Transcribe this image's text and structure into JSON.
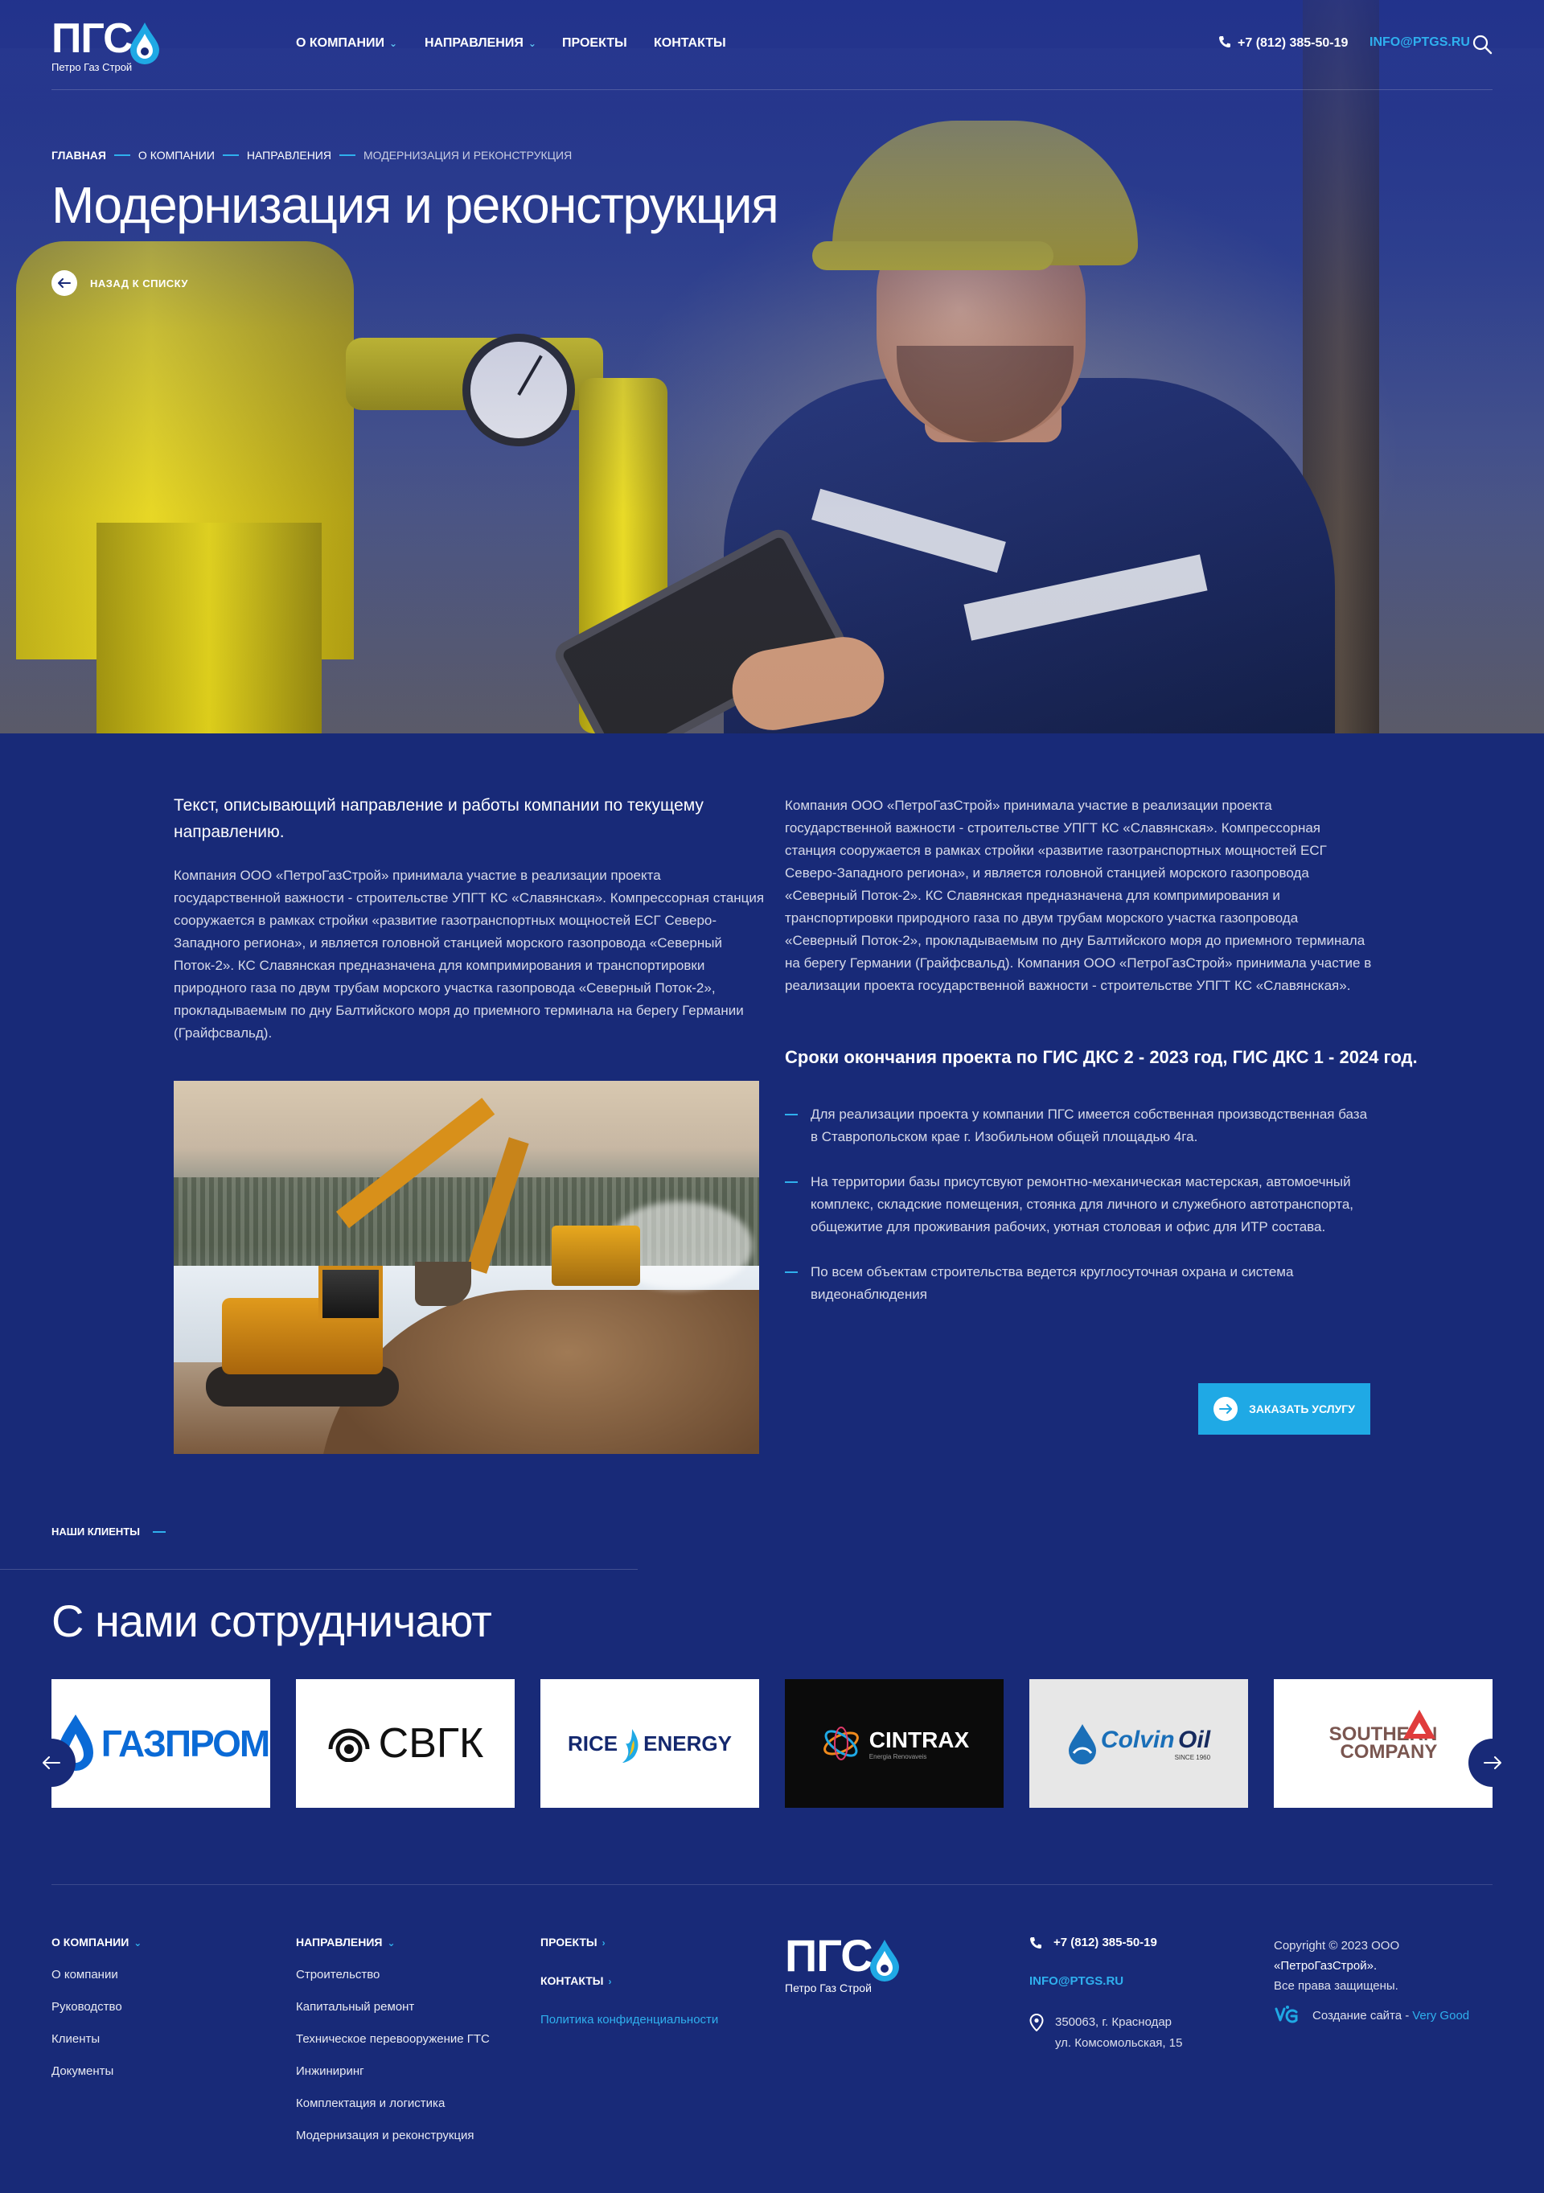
{
  "header": {
    "logo_text": "ПГС",
    "logo_subtitle": "Петро Газ Строй",
    "nav": [
      {
        "label": "О КОМПАНИИ",
        "has_dropdown": true
      },
      {
        "label": "НАПРАВЛЕНИЯ",
        "has_dropdown": true
      },
      {
        "label": "ПРОЕКТЫ",
        "has_dropdown": false
      },
      {
        "label": "КОНТАКТЫ",
        "has_dropdown": false
      }
    ],
    "phone": "+7 (812) 385-50-19",
    "email": "INFO@PTGS.RU",
    "search_icon": "search-icon"
  },
  "hero": {
    "breadcrumb": [
      "ГЛАВНАЯ",
      "О КОМПАНИИ",
      "НАПРАВЛЕНИЯ",
      "МОДЕРНИЗАЦИЯ И РЕКОНСТРУКЦИЯ"
    ],
    "title": "Модернизация и реконструкция",
    "back_label": "НАЗАД К СПИСКУ"
  },
  "content": {
    "lead": "Текст, описывающий направление и работы компании по текущему направлению.",
    "left_paragraph": "Компания ООО «ПетроГазСтрой» принимала участие в реализации проекта государственной важности -  строительстве УПГТ КС «Славянская». Компрессорная станция сооружается в рамках стройки «развитие газотранспортных мощностей ЕСГ Северо-Западного региона», и является головной станцией морского газопровода «Северный Поток-2». КС Славянская предназначена для компримирования и транспортировки природного газа по двум трубам морского участка  газопровода «Северный Поток-2», прокладываемым по дну Балтийского моря до приемного терминала на берегу Германии (Грайфсвальд).",
    "right_paragraph": "Компания ООО «ПетроГазСтрой» принимала участие в реализации проекта государственной важности -  строительстве УПГТ КС «Славянская». Компрессорная станция сооружается в рамках стройки «развитие газотранспортных мощностей ЕСГ Северо-Западного региона», и является головной станцией морского газопровода «Северный Поток-2». КС Славянская предназначена для компримирования и транспортировки природного газа по двум трубам морского участка  газопровода «Северный Поток-2», прокладываемым по дну Балтийского моря до приемного терминала на берегу Германии (Грайфсвальд). Компания ООО «ПетроГазСтрой» принимала участие в реализации проекта государственной важности -  строительстве УПГТ КС «Славянская».",
    "deadline_heading": "Сроки окончания проекта по ГИС ДКС 2 - 2023 год, ГИС ДКС 1 - 2024 год.",
    "bullets": [
      "Для реализации проекта у компании ПГС имеется собственная производственная база в Ставропольском крае г. Изобильном общей площадью 4га.",
      "На территории базы присутсвуют ремонтно-механическая мастерская, автомоечный комплекс, складские помещения, стоянка для личного и служебного автотранспорта, общежитие для проживания рабочих, уютная столовая и офис для ИТР состава.",
      "По всем объектам строительства ведется круглосуточная охрана и система видеонаблюдения"
    ],
    "order_button": "ЗАКАЗАТЬ УСЛУГУ"
  },
  "clients": {
    "label": "НАШИ КЛИЕНТЫ",
    "title": "С нами сотрудничают",
    "logos": [
      {
        "name": "ГАЗПРОМ"
      },
      {
        "name": "СВГК"
      },
      {
        "name_a": "RICE",
        "name_b": "ENERGY"
      },
      {
        "name": "CINTRAX",
        "tagline": "Energia Renovaveis"
      },
      {
        "name_a": "Colvin",
        "name_b": "Oil",
        "tagline": "SINCE 1960"
      },
      {
        "name_a": "SOUTHERN",
        "name_b": "COMPANY"
      }
    ]
  },
  "footer": {
    "col1": {
      "head": "О КОМПАНИИ",
      "links": [
        "О компании",
        "Руководство",
        "Клиенты",
        "Документы"
      ]
    },
    "col2": {
      "head": "НАПРАВЛЕНИЯ",
      "links": [
        "Строительство",
        "Капитальный ремонт",
        "Техническое перевооружение ГТС",
        "Инжиниринг",
        "Комплектация и логистика",
        "Модернизация и реконструкция"
      ]
    },
    "col3": {
      "projects": "ПРОЕКТЫ",
      "contacts": "КОНТАКТЫ",
      "policy": "Политика конфиденциальности"
    },
    "logo_text": "ПГС",
    "logo_subtitle": "Петро Газ Строй",
    "phone": "+7 (812) 385-50-19",
    "email": "INFO@PTGS.RU",
    "address_line1": "350063, г. Краснодар",
    "address_line2": "ул. Комсомольская, 15",
    "copyright_prefix": "Copyright © 2023 ООО",
    "copyright_company": "«ПетроГазСтрой».",
    "copyright_rights": "Все права защищены.",
    "dev_label": "Создание сайта -",
    "dev_name": "Very Good"
  },
  "colors": {
    "background": "#182a78",
    "accent": "#2fb0ee",
    "button": "#1fa9e5"
  }
}
